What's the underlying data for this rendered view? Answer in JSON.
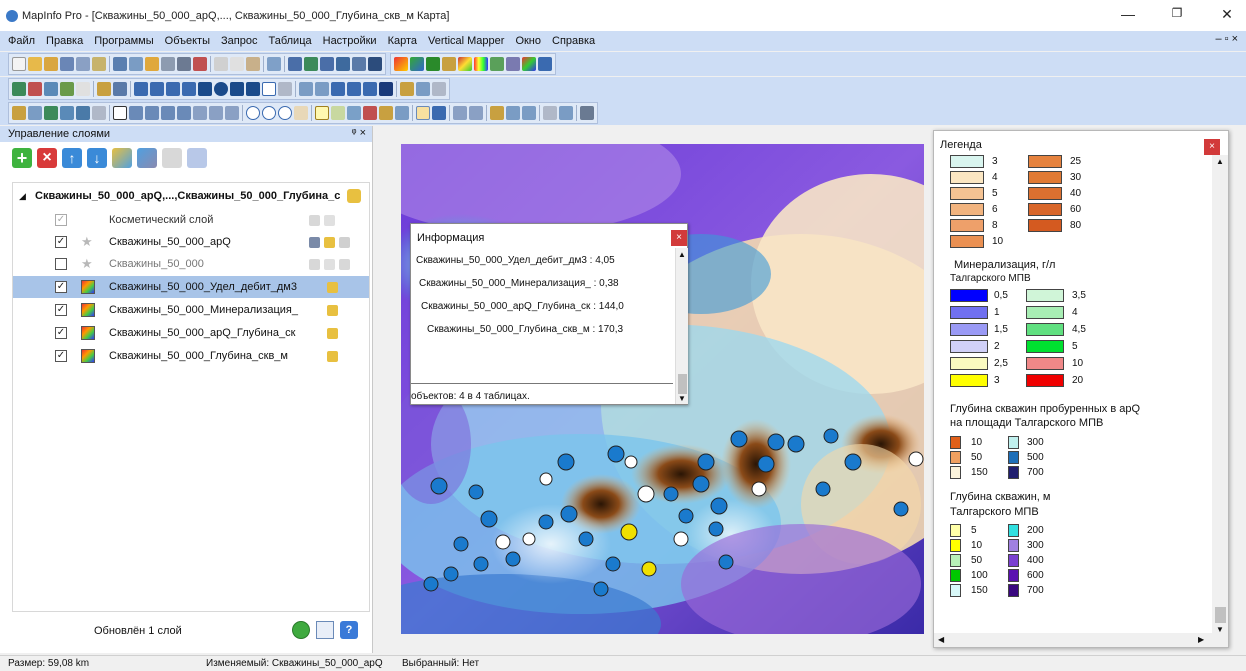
{
  "window": {
    "title": "MapInfo Pro - [Скважины_50_000_apQ,..., Скважины_50_000_Глубина_скв_м Карта]"
  },
  "menu": [
    "Файл",
    "Правка",
    "Программы",
    "Объекты",
    "Запрос",
    "Таблица",
    "Настройки",
    "Карта",
    "Vertical Mapper",
    "Окно",
    "Справка"
  ],
  "layer_panel": {
    "title": "Управление слоями",
    "map_group": "Скважины_50_000_apQ,...,Скважины_50_000_Глубина_с",
    "layers": [
      {
        "name": "Косметический слой",
        "checked": true,
        "enabled": false,
        "icon": "none"
      },
      {
        "name": "Скважины_50_000_apQ",
        "checked": true,
        "enabled": true,
        "icon": "star"
      },
      {
        "name": "Скважины_50_000",
        "checked": false,
        "enabled": false,
        "icon": "star"
      },
      {
        "name": "Скважины_50_000_Удел_дебит_дм3",
        "checked": true,
        "enabled": true,
        "icon": "grid",
        "selected": true
      },
      {
        "name": "Скважины_50_000_Минерализация_",
        "checked": true,
        "enabled": true,
        "icon": "grid"
      },
      {
        "name": "Скважины_50_000_apQ_Глубина_ск",
        "checked": true,
        "enabled": true,
        "icon": "grid"
      },
      {
        "name": "Скважины_50_000_Глубина_скв_м",
        "checked": true,
        "enabled": true,
        "icon": "grid"
      }
    ],
    "footer": "Обновлён 1 слой"
  },
  "info_window": {
    "title": "Информация",
    "lines": [
      "Скважины_50_000_Удел_дебит_дм3 : 4,05",
      "Скважины_50_000_Минерализация_ : 0,38",
      "Скважины_50_000_apQ_Глубина_ск : 144,0",
      "Скважины_50_000_Глубина_скв_м : 170,3"
    ],
    "footer": "объектов: 4 в 4 таблицах."
  },
  "legend": {
    "title": "Легенда",
    "yield_left": [
      {
        "label": "3",
        "color": "#d9f5ef"
      },
      {
        "label": "4",
        "color": "#fbe6c2"
      },
      {
        "label": "5",
        "color": "#f5c393"
      },
      {
        "label": "6",
        "color": "#f2b47f"
      },
      {
        "label": "8",
        "color": "#eea06a"
      },
      {
        "label": "10",
        "color": "#ea9052"
      }
    ],
    "yield_right": [
      {
        "label": "25",
        "color": "#e5823e"
      },
      {
        "label": "30",
        "color": "#e07a34"
      },
      {
        "label": "40",
        "color": "#dc7030"
      },
      {
        "label": "60",
        "color": "#d8662a"
      },
      {
        "label": "80",
        "color": "#d45a20"
      }
    ],
    "mineral_title": "Минерализация, г/л",
    "mineral_subtitle": "Талгарского МПВ",
    "mineral_left": [
      {
        "label": "0,5",
        "color": "#0000ff"
      },
      {
        "label": "1",
        "color": "#7070f0"
      },
      {
        "label": "1,5",
        "color": "#9a9af5"
      },
      {
        "label": "2",
        "color": "#d0d0f8"
      },
      {
        "label": "2,5",
        "color": "#fafac0"
      },
      {
        "label": "3",
        "color": "#ffff00"
      }
    ],
    "mineral_right": [
      {
        "label": "3,5",
        "color": "#d0f5d8"
      },
      {
        "label": "4",
        "color": "#a8eeb4"
      },
      {
        "label": "4,5",
        "color": "#60e080"
      },
      {
        "label": "5",
        "color": "#00e030"
      },
      {
        "label": "10",
        "color": "#f08888"
      },
      {
        "label": "20",
        "color": "#f00000"
      }
    ],
    "apq_title_1": "Глубина скважин пробуренных в apQ",
    "apq_title_2": "на площади Талгарского МПВ",
    "apq_left": [
      {
        "label": "10",
        "color": "#e0601a"
      },
      {
        "label": "50",
        "color": "#f0a060"
      },
      {
        "label": "150",
        "color": "#fcf4dc"
      }
    ],
    "apq_right": [
      {
        "label": "300",
        "color": "#c0f0ee"
      },
      {
        "label": "500",
        "color": "#1f6fb8"
      },
      {
        "label": "700",
        "color": "#201e6e"
      }
    ],
    "depth_title_1": "Глубина скважин, м",
    "depth_title_2": "Талгарского МПВ",
    "depth_left": [
      {
        "label": "5",
        "color": "#ffffa8"
      },
      {
        "label": "10",
        "color": "#ffff00"
      },
      {
        "label": "50",
        "color": "#b8f0b8"
      },
      {
        "label": "100",
        "color": "#00c800"
      },
      {
        "label": "150",
        "color": "#d8f8f8"
      }
    ],
    "depth_right": [
      {
        "label": "200",
        "color": "#30e0e0"
      },
      {
        "label": "300",
        "color": "#a080e0"
      },
      {
        "label": "400",
        "color": "#7a40d0"
      },
      {
        "label": "600",
        "color": "#5a10b0"
      },
      {
        "label": "700",
        "color": "#3a0880"
      }
    ]
  },
  "status": {
    "size": "Размер: 59,08 km",
    "editable": "Изменяемый: Скважины_50_000_apQ",
    "selected": "Выбранный: Нет"
  },
  "colors": {
    "menubar": "#cdddf5",
    "selection": "#a8c4e8",
    "close_red": "#d23a3a"
  }
}
